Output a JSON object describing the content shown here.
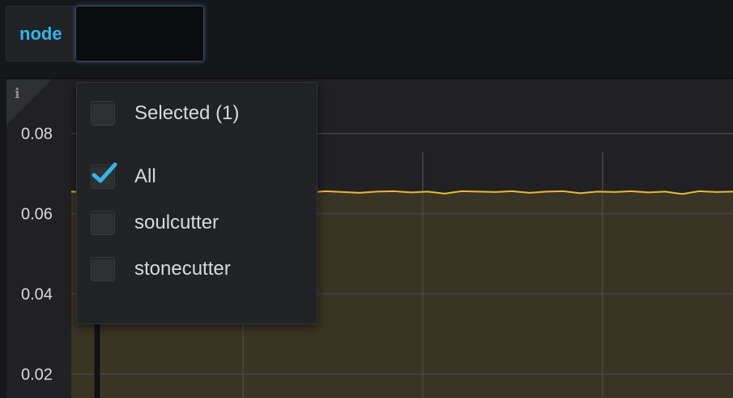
{
  "variable": {
    "label": "node",
    "input_value": ""
  },
  "dropdown": {
    "items": [
      {
        "label": "Selected (1)",
        "checked": false
      },
      {
        "label": "All",
        "checked": true
      },
      {
        "label": "soulcutter",
        "checked": false
      },
      {
        "label": "stonecutter",
        "checked": false
      }
    ]
  },
  "panel": {
    "info_icon": "info-icon",
    "info_glyph": "i"
  },
  "colors": {
    "accent": "#33b5e5",
    "series_line": "#eab839",
    "series_fill": "#3a3424",
    "grid": "#464646",
    "check": "#33b5e5"
  },
  "chart_data": {
    "type": "area",
    "y_ticks": [
      "0.08",
      "0.06",
      "0.04",
      "0.02"
    ],
    "y_tick_values": [
      0.08,
      0.06,
      0.04,
      0.02
    ],
    "ylim": [
      0.014,
      0.0935
    ],
    "series": [
      {
        "values": [
          0.0655,
          0.0653,
          0.0656,
          0.0654,
          0.0652,
          0.0656,
          0.0655,
          0.0651,
          0.0656,
          0.0654,
          0.0655,
          0.0649,
          0.0656,
          0.0655,
          0.0653,
          0.0656,
          0.0654,
          0.0652,
          0.0655,
          0.0656,
          0.0653,
          0.0655,
          0.065,
          0.0656,
          0.0655,
          0.0654,
          0.0656,
          0.0652,
          0.0655,
          0.0656,
          0.0651,
          0.0655,
          0.0654,
          0.0656,
          0.0653,
          0.0655,
          0.0649,
          0.0656,
          0.0654,
          0.0655
        ]
      }
    ],
    "grid": true
  }
}
